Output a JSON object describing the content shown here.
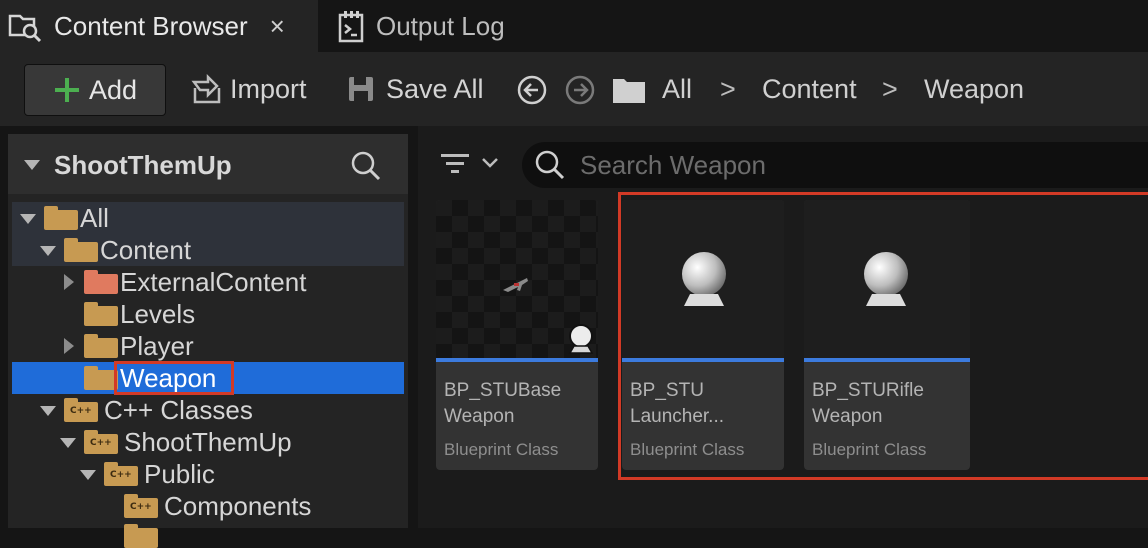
{
  "tabs": [
    {
      "label": "Content Browser",
      "icon": "content-browser-icon",
      "active": true,
      "close": "×"
    },
    {
      "label": "Output Log",
      "icon": "output-log-icon",
      "active": false
    }
  ],
  "toolbar": {
    "add_label": "Add",
    "import_label": "Import",
    "save_all_label": "Save All"
  },
  "breadcrumb": {
    "items": [
      "All",
      "Content",
      "Weapon"
    ],
    "separator": ">"
  },
  "sources_panel": {
    "title": "ShootThemUp",
    "tree": [
      {
        "label": "All",
        "expanded": true
      },
      {
        "label": "Content",
        "expanded": true
      },
      {
        "label": "ExternalContent",
        "collapsed": true
      },
      {
        "label": "Levels"
      },
      {
        "label": "Player",
        "collapsed": true
      },
      {
        "label": "Weapon",
        "selected": true
      },
      {
        "label": "C++ Classes",
        "expanded": true
      },
      {
        "label": "ShootThemUp",
        "expanded": true
      },
      {
        "label": "Public",
        "expanded": true
      },
      {
        "label": "Components"
      }
    ]
  },
  "search": {
    "placeholder": "Search Weapon"
  },
  "assets": [
    {
      "name_line1": "BP_STUBase",
      "name_line2": "Weapon",
      "type": "Blueprint Class"
    },
    {
      "name_line1": "BP_STU",
      "name_line2": "Launcher...",
      "type": "Blueprint Class"
    },
    {
      "name_line1": "BP_STURifle",
      "name_line2": "Weapon",
      "type": "Blueprint Class"
    }
  ],
  "colors": {
    "accent_add": "#4caf50",
    "selection": "#1f6cd9",
    "annotation_red": "#d23a26",
    "folder": "#c79a52",
    "folder_external": "#e07a5f",
    "asset_strip": "#3c7bde"
  }
}
